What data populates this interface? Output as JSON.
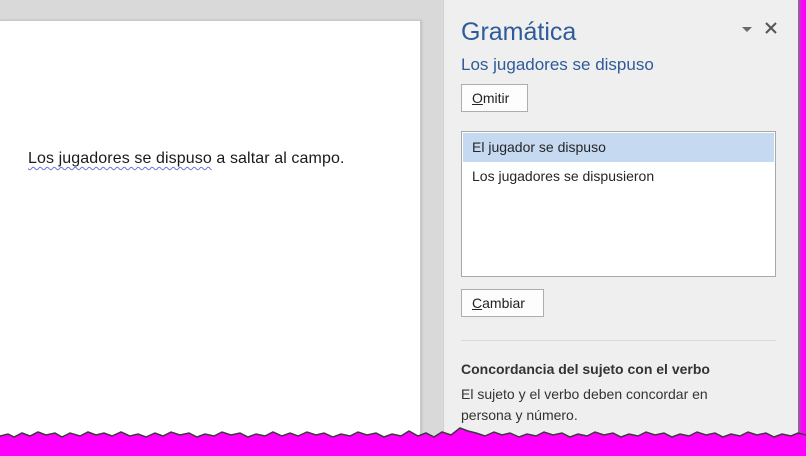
{
  "document": {
    "sentence_error": "Los jugadores se dispuso",
    "sentence_rest": " a saltar al campo."
  },
  "pane": {
    "title": "Gramática",
    "error_sentence": "Los jugadores se dispuso",
    "omit_label_accel": "O",
    "omit_label_rest": "mitir",
    "suggestions": [
      {
        "text": "El jugador se dispuso",
        "selected": true
      },
      {
        "text": "Los jugadores se dispusieron",
        "selected": false
      }
    ],
    "change_label_accel": "C",
    "change_label_rest": "ambiar",
    "rule_title": "Concordancia del sujeto con el verbo",
    "rule_description": "El sujeto y el verbo deben concordar en persona y número.",
    "icons": {
      "options": "dropdown-triangle-icon",
      "close": "close-icon"
    }
  },
  "colors": {
    "pane_title": "#2e5b9a",
    "selection": "#c5d9f1",
    "wavy_underline": "#6b72d9",
    "frame_background": "#ff00ff"
  }
}
